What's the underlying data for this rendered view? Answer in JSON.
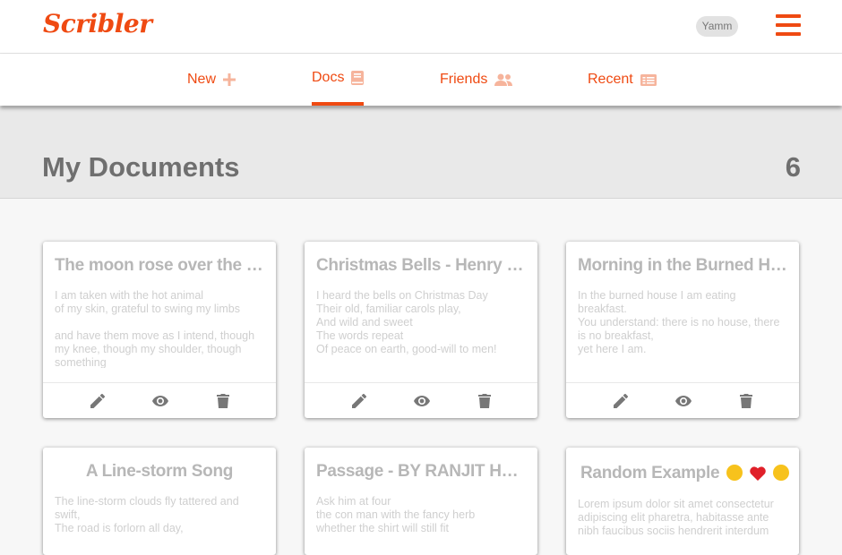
{
  "app": {
    "logo": "Scribler",
    "user": "Yamm"
  },
  "colors": {
    "brand": "#ef4a12",
    "tab_icon": "#f6b49c",
    "action_icon": "#777777"
  },
  "nav": {
    "tabs": [
      {
        "label": "New",
        "icon": "plus-icon"
      },
      {
        "label": "Docs",
        "icon": "book-icon",
        "active": true
      },
      {
        "label": "Friends",
        "icon": "users-icon"
      },
      {
        "label": "Recent",
        "icon": "list-icon"
      }
    ]
  },
  "header": {
    "title": "My Documents",
    "count": "6"
  },
  "actions": [
    "pencil-icon",
    "eye-icon",
    "trash-icon"
  ],
  "documents": [
    {
      "title": "The moon rose over the bay. I had a lot of feelings.",
      "preview": "I am taken with the hot animal\nof my skin, grateful to swing my limbs\n\nand have them move as I intend, though\nmy knee, though my shoulder, though\nsomething\nis always wrong"
    },
    {
      "title": "Christmas Bells - Henry Wadsworth Longfellow",
      "preview": "I heard the bells on Christmas Day\nTheir old, familiar carols play,\nAnd wild and sweet\nThe words repeat\nOf peace on earth, good-will to men!\n\nAnd thought how, as the day had come"
    },
    {
      "title": "Morning in the Burned House",
      "preview": "In the burned house I am eating\nbreakfast.\nYou understand: there is no house, there\nis no breakfast,\nyet here I am.\n\nThe spoon which was melted scrapes"
    },
    {
      "title": "A Line-storm Song",
      "preview": "The line-storm clouds fly tattered and\nswift,\nThe road is forlorn all day,"
    },
    {
      "title": "Passage - BY RANJIT HOSKOTE",
      "preview": "Ask him at four\nthe con man with the fancy herb\nwhether the shirt will still fit"
    },
    {
      "title": "Random Example",
      "preview": "Lorem ipsum dolor sit amet consectetur\nadipiscing elit pharetra, habitasse ante\nnibh faucibus sociis hendrerit interdum"
    }
  ]
}
